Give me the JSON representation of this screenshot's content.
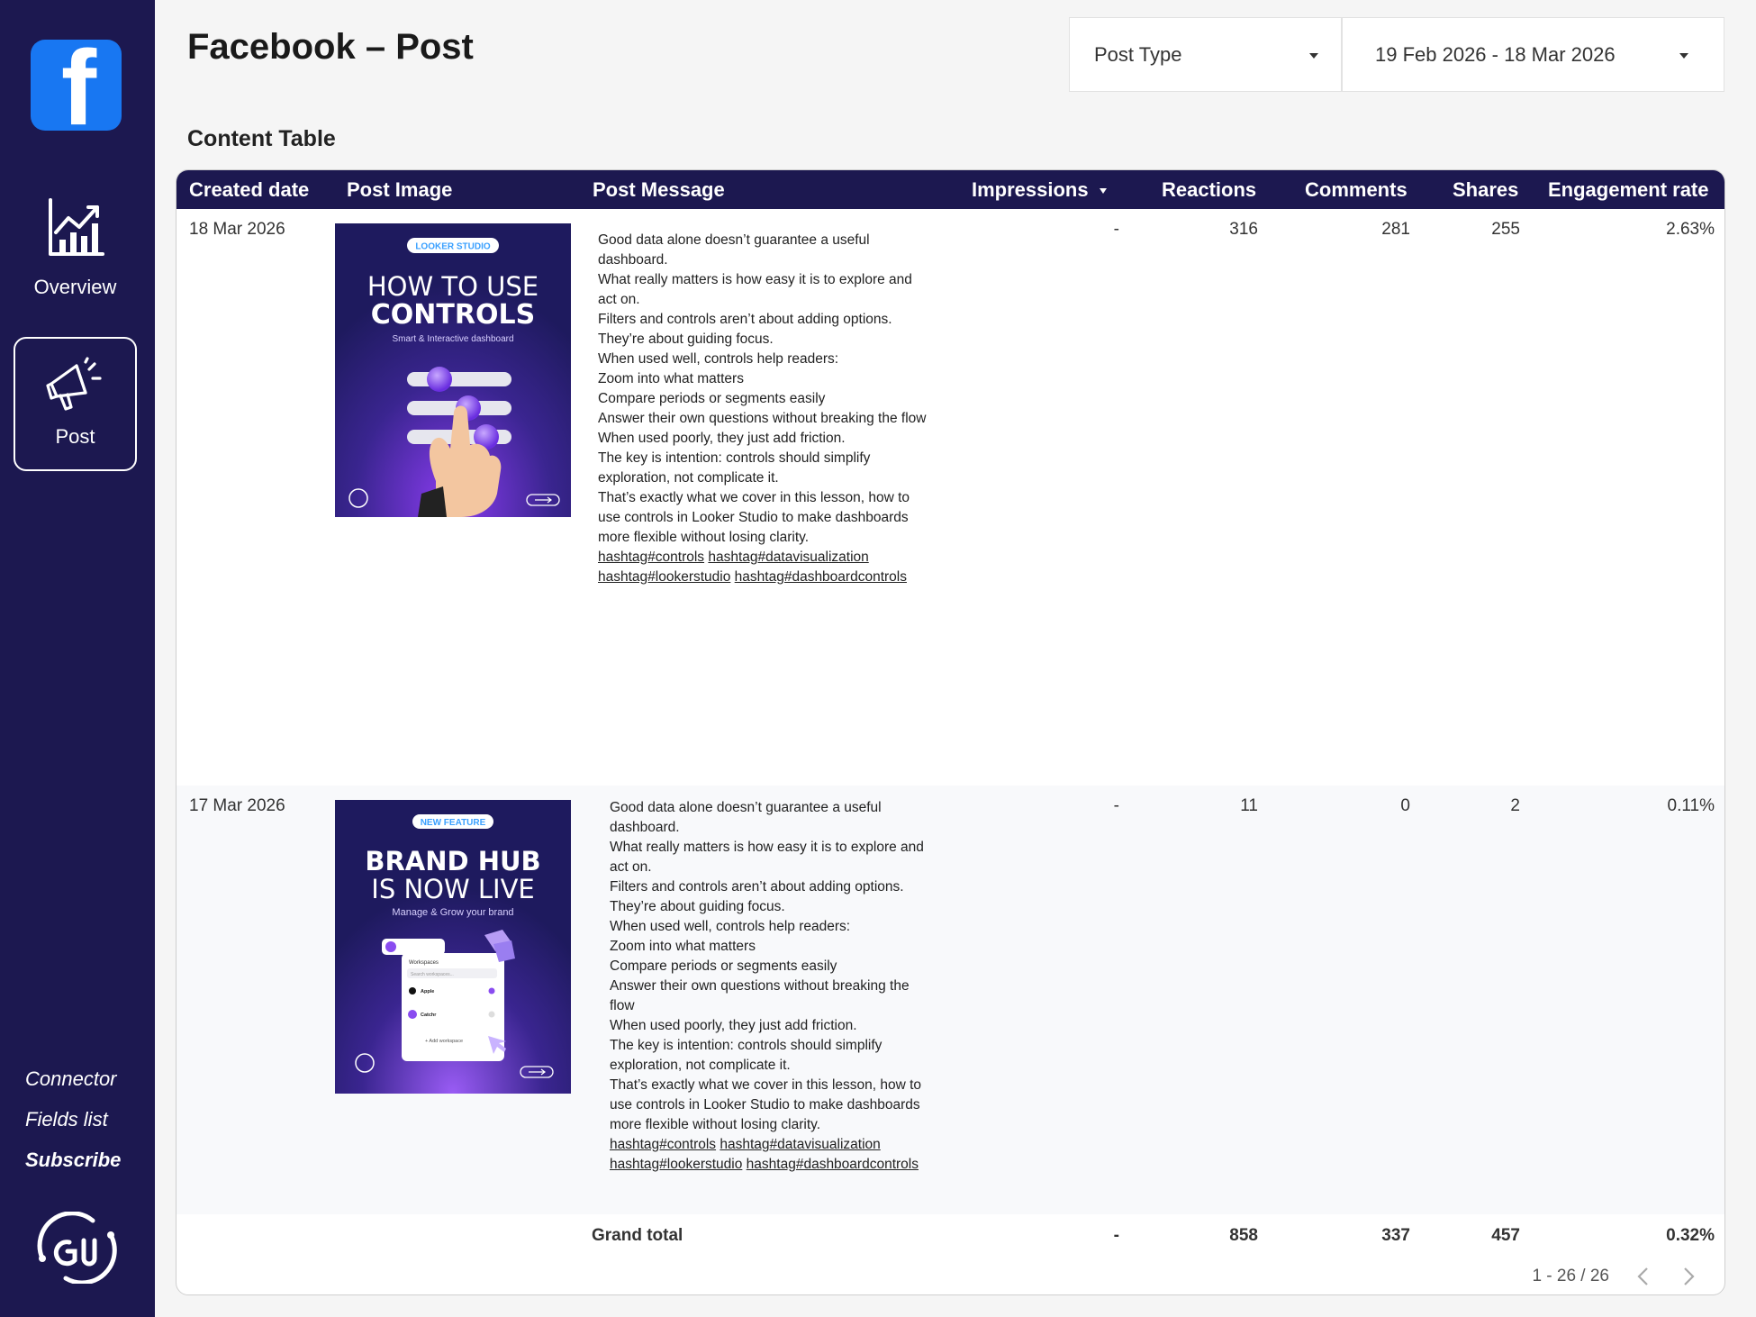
{
  "app": {
    "title": "Facebook – Post",
    "logo_letter": "f"
  },
  "sidebar": {
    "items": [
      {
        "label": "Overview",
        "icon": "chart-icon"
      },
      {
        "label": "Post",
        "icon": "megaphone-icon"
      }
    ],
    "links": [
      "Connector",
      "Fields list",
      "Subscribe"
    ]
  },
  "controls": {
    "post_type": "Post Type",
    "date_range": "19 Feb 2026 - 18 Mar 2026"
  },
  "section_title": "Content Table",
  "table": {
    "columns": [
      "Created date",
      "Post Image",
      "Post Message",
      "Impressions",
      "Reactions",
      "Comments",
      "Shares",
      "Engagement rate"
    ],
    "rows": [
      {
        "created_date": "18 Mar 2026",
        "image": {
          "badge": "LOOKER STUDIO",
          "title_line1": "HOW TO USE",
          "title_line2": "CONTROLS",
          "subtitle": "Smart & Interactive dashboard"
        },
        "message_lines": [
          "Good data alone doesn’t guarantee a useful",
          "dashboard.",
          "What really matters is how easy it is to explore and",
          "act on.",
          "Filters and controls aren’t about adding options.",
          "They’re about guiding focus.",
          "When used well, controls help readers:",
          "Zoom into what matters",
          "Compare periods or segments easily",
          "Answer their own questions without breaking the flow",
          "When used poorly, they just add friction.",
          "The key is intention: controls should simplify",
          "exploration, not complicate it.",
          "That’s exactly what we cover in this lesson, how to",
          "use controls in Looker Studio to make dashboards",
          "more flexible without losing clarity."
        ],
        "hashtags": [
          [
            "hashtag#controls",
            "hashtag#datavisualization"
          ],
          [
            "hashtag#lookerstudio",
            "hashtag#dashboardcontrols"
          ]
        ],
        "impressions": "-",
        "reactions": "316",
        "comments": "281",
        "shares": "255",
        "engagement_rate": "2.63%"
      },
      {
        "created_date": "17 Mar 2026",
        "image": {
          "badge": "NEW FEATURE",
          "title_line1": "BRAND HUB",
          "title_line2": "IS NOW LIVE",
          "subtitle": "Manage & Grow your brand",
          "panel_title": "Workspaces",
          "panel_search": "Search workspaces...",
          "panel_item1": "Apple",
          "panel_item2": "Catchr",
          "panel_add": "+ Add workspace"
        },
        "message_lines": [
          "Good data alone doesn’t guarantee a useful",
          "dashboard.",
          "What really matters is how easy it is to explore and",
          "act on.",
          "Filters and controls aren’t about adding options.",
          "They’re about guiding focus.",
          "When used well, controls help readers:",
          "Zoom into what matters",
          "Compare periods or segments easily",
          "Answer their own questions without breaking the",
          "flow",
          "When used poorly, they just add friction.",
          "The key is intention: controls should simplify",
          "exploration, not complicate it.",
          "That’s exactly what we cover in this lesson, how to",
          "use controls in Looker Studio to make dashboards",
          "more flexible without losing clarity."
        ],
        "hashtags": [
          [
            "hashtag#controls",
            "hashtag#datavisualization"
          ],
          [
            "hashtag#lookerstudio",
            "hashtag#dashboardcontrols"
          ]
        ],
        "impressions": "-",
        "reactions": "11",
        "comments": "0",
        "shares": "2",
        "engagement_rate": "0.11%"
      }
    ],
    "total": {
      "label": "Grand total",
      "impressions": "-",
      "reactions": "858",
      "comments": "337",
      "shares": "457",
      "engagement_rate": "0.32%"
    },
    "pagination": "1 - 26 / 26"
  },
  "colors": {
    "sidebar": "#1c1850",
    "header": "#1c1850",
    "facebook_blue": "#1877f2"
  }
}
